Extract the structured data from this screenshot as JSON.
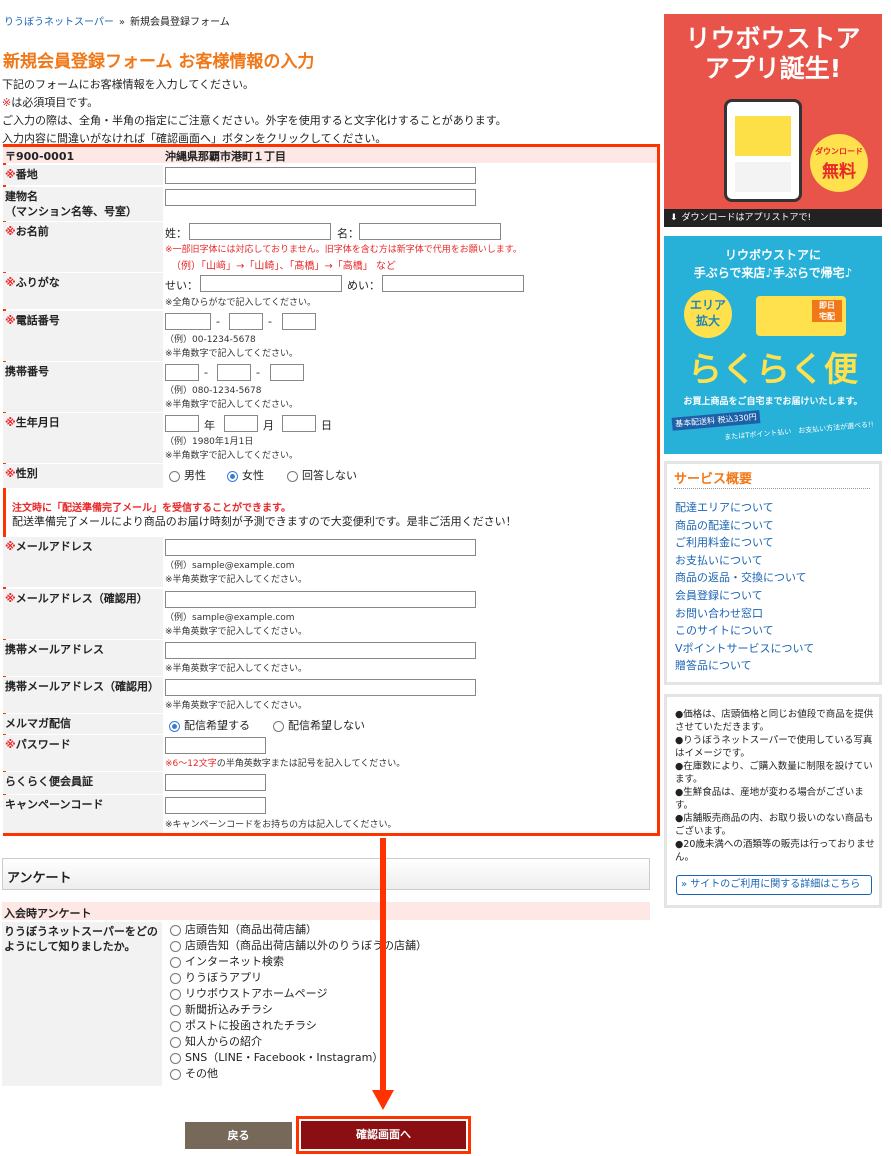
{
  "breadcrumb": {
    "home": "りうぼうネットスーパー",
    "sep": "»",
    "current": "新規会員登録フォーム"
  },
  "page_title": "新規会員登録フォーム お客様情報の入力",
  "intro": {
    "line1": "下記のフォームにお客様情報を入力してください。",
    "line2_mark": "※",
    "line2": "は必須項目です。",
    "line3": "ご入力の際は、全角・半角の指定にご注意ください。外字を使用すると文字化けすることがあります。",
    "line4": "入力内容に間違いがなければ「確認画面へ」ボタンをクリックしてください。"
  },
  "form": {
    "zip_label": "〒900-0001",
    "zip_address": "沖縄県那覇市港町１丁目",
    "req_mark": "※",
    "banchi_label": "番地",
    "building_label": "建物名\n（マンション名等、号室）",
    "name_label": "お名前",
    "sei": "姓：",
    "mei": "名：",
    "name_note1": "※一部旧字体には対応しておりません。旧字体を含む方は新字体で代用をお願いします。",
    "name_note2": "（例）「山﨑」→「山崎」、「髙橋」→「高橋」 など",
    "kana_label": "ふりがな",
    "sei_kana": "せい：",
    "mei_kana": "めい：",
    "kana_note": "※全角ひらがなで記入してください。",
    "tel_label": "電話番号",
    "tel_example": "（例）00-1234-5678",
    "tel_note": "※半角数字で記入してください。",
    "mobile_label": "携帯番号",
    "mobile_example": "（例）080-1234-5678",
    "mobile_note": "※半角数字で記入してください。",
    "dash": "-",
    "birth_label": "生年月日",
    "year": "年",
    "month": "月",
    "day": "日",
    "birth_example": "（例）1980年1月1日",
    "birth_note": "※半角数字で記入してください。",
    "gender_label": "性別",
    "gender_options": [
      "男性",
      "女性",
      "回答しない"
    ],
    "mail_notice_title": "注文時に「配送準備完了メール」を受信することができます。",
    "mail_notice_body": "配送準備完了メールにより商品のお届け時刻が予測できますので大変便利です。是非ご活用ください！",
    "email_label": "メールアドレス",
    "email_example": "（例）sample@example.com",
    "email_note": "※半角英数字で記入してください。",
    "email2_label": "メールアドレス（確認用）",
    "mobile_email_label": "携帯メールアドレス",
    "mobile_email2_label": "携帯メールアドレス（確認用）",
    "magazine_label": "メルマガ配信",
    "magazine_options": [
      "配信希望する",
      "配信希望しない"
    ],
    "password_label": "パスワード",
    "password_note_red": "※6〜12文字",
    "password_note": "の半角英数字または記号を記入してください。",
    "rakuraku_label": "らくらく便会員証",
    "campaign_label": "キャンペーンコード",
    "campaign_note": "※キャンペーンコードをお持ちの方は記入してください。"
  },
  "survey": {
    "heading": "アンケート",
    "sub_heading": "入会時アンケート",
    "question": "りうぼうネットスーパーをどのようにして知りましたか。",
    "options": [
      "店頭告知（商品出荷店舗）",
      "店頭告知（商品出荷店舗以外のりうぼうの店舗）",
      "インターネット検索",
      "りうぼうアプリ",
      "リウボウストアホームページ",
      "新聞折込みチラシ",
      "ポストに投函されたチラシ",
      "知人からの紹介",
      "SNS（LINE・Facebook・Instagram）",
      "その他"
    ]
  },
  "buttons": {
    "back": "戻る",
    "confirm": "確認画面へ"
  },
  "sidebar": {
    "banner1": {
      "line1": "リウボウストア",
      "line2": "アプリ誕生!",
      "badge1": "ダウンロード",
      "badge2": "無料",
      "bottom": "ダウンロードはアプリストアで!"
    },
    "banner2": {
      "line1": "リウボウストアに",
      "line2": "手ぶらで来店♪手ぶらで帰宅♪",
      "tag1": "エリア",
      "tag2": "拡大",
      "tag3": "即日",
      "tag4": "宅配",
      "big": "らくらく便",
      "sub": "お買上商品をご自宅までお届けいたします。",
      "fee": "基本配送料 税込330円",
      "pay": "またはTポイント払い　お支払い方法が選べる!!"
    },
    "service_title": "サービス概要",
    "service_links": [
      "配達エリアについて",
      "商品の配達について",
      "ご利用料金について",
      "お支払いについて",
      "商品の返品・交換について",
      "会員登録について",
      "お問い合わせ窓口",
      "このサイトについて",
      "Vポイントサービスについて",
      "贈答品について"
    ],
    "notes": [
      "●価格は、店頭価格と同じお値段で商品を提供させていただきます。",
      "●りうぼうネットスーパーで使用している写真はイメージです。",
      "●在庫数により、ご購入数量に制限を設けています。",
      "●生鮮食品は、産地が変わる場合がございます。",
      "●店舗販売商品の内、お取り扱いのない商品もございます。",
      "●20歳未満への酒類等の販売は行っておりません。"
    ],
    "detail_link": "» サイトのご利用に関する詳細はこちら"
  },
  "colors": {
    "accent": "#f07818",
    "required": "#e8282a",
    "annotation": "#ff3300",
    "confirm_btn": "#8a0e12",
    "back_btn": "#76695a"
  }
}
